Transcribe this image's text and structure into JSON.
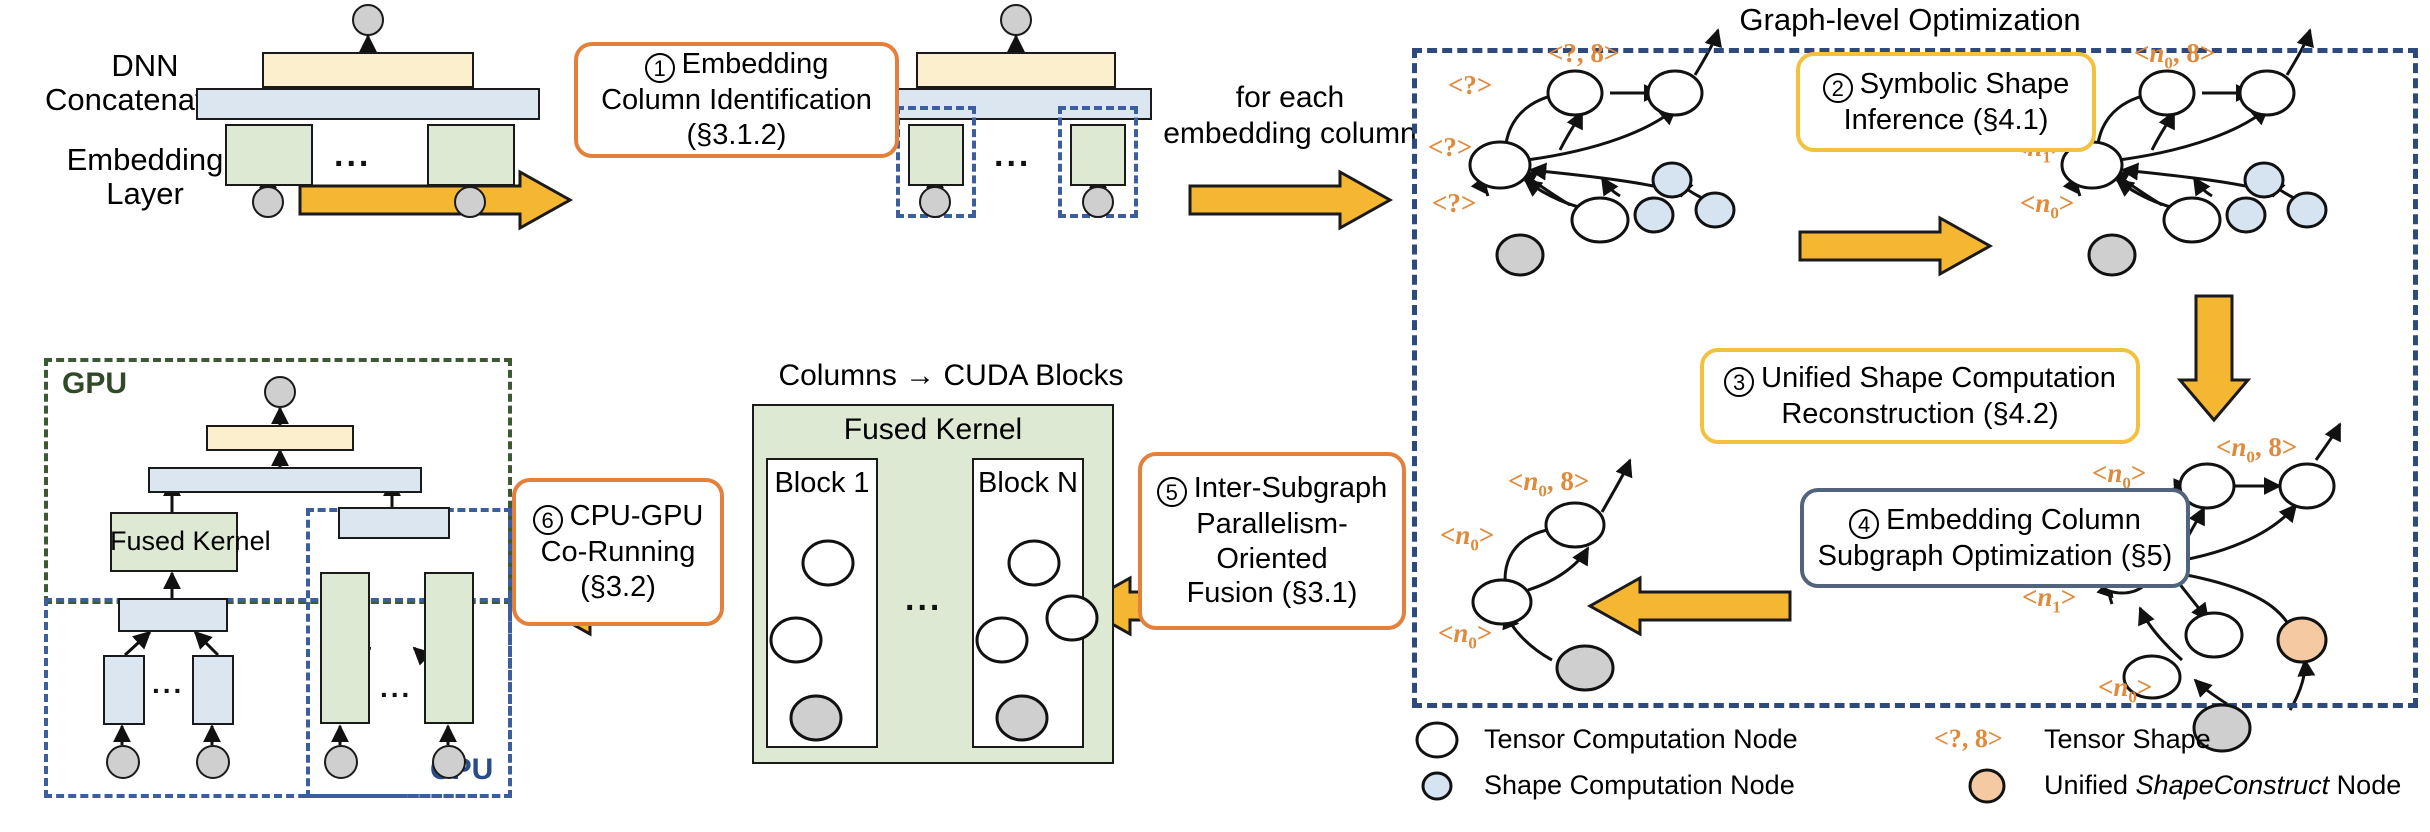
{
  "figure": {
    "panel_titles": {
      "graph_level_optimization": "Graph-level Optimization",
      "columns_to_cuda_blocks": "Columns → CUDA Blocks"
    },
    "left_labels": {
      "dnn": "DNN",
      "concatenation": "Concatenation",
      "embedding": "Embedding",
      "layer": "Layer"
    },
    "flow_labels": {
      "for_each": "for each",
      "embedding_column": "embedding column"
    },
    "device_labels": {
      "gpu": "GPU",
      "cpu": "CPU"
    },
    "kernel_labels": {
      "fused_kernel_left": "Fused Kernel",
      "fused_kernel_center": "Fused Kernel",
      "block_first": "Block 1",
      "block_last": "Block N",
      "ellipsis": "..."
    }
  },
  "steps": [
    {
      "id": 1,
      "number": "①",
      "num_plain": "1",
      "lines": [
        "Embedding",
        "Column Identification",
        "(§3.1.2)"
      ],
      "accent": "#E2803C",
      "style": "orange"
    },
    {
      "id": 2,
      "number": "②",
      "num_plain": "2",
      "lines": [
        "Symbolic Shape",
        "Inference (§4.1)"
      ],
      "accent": "#F2C13E",
      "style": "yellow"
    },
    {
      "id": 3,
      "number": "③",
      "num_plain": "3",
      "lines": [
        "Unified Shape Computation",
        "Reconstruction (§4.2)"
      ],
      "accent": "#F2C13E",
      "style": "yellow"
    },
    {
      "id": 4,
      "number": "④",
      "num_plain": "4",
      "lines": [
        "Embedding Column",
        "Subgraph Optimization (§5)"
      ],
      "accent": "#52637C",
      "style": "navy"
    },
    {
      "id": 5,
      "number": "⑤",
      "num_plain": "5",
      "lines": [
        "Inter-Subgraph",
        "Parallelism-",
        "Oriented",
        "Fusion (§3.1)"
      ],
      "accent": "#E2803C",
      "style": "orange"
    },
    {
      "id": 6,
      "number": "⑥",
      "num_plain": "6",
      "lines": [
        "CPU-GPU",
        "Co-Running",
        "(§3.2)"
      ],
      "accent": "#E2803C",
      "style": "orange"
    }
  ],
  "legend": {
    "items": [
      {
        "key": "tensor-computation-node",
        "label": "Tensor Computation Node",
        "color": "#ffffff",
        "shape": "ellipse"
      },
      {
        "key": "shape-computation-node",
        "label": "Shape Computation Node",
        "color": "#D6E3F0",
        "shape": "ellipse"
      },
      {
        "key": "tensor-shape",
        "label": "Tensor Shape",
        "color": "#E08A3C",
        "shape": "tag",
        "tag_text": "<?, 8>"
      },
      {
        "key": "unified-shapeconstruct-node",
        "label_pre": "Unified ",
        "label_em": "ShapeConstruct",
        "label_post": " Node",
        "label": "Unified ShapeConstruct Node",
        "color": "#F5C9A2",
        "shape": "ellipse"
      }
    ]
  },
  "shape_tags": {
    "unknown": "<?>",
    "unknown_8": "<?, 8>",
    "n0": "<n0>",
    "n1": "<n1>",
    "n0_8": "<n0, 8>"
  },
  "colors": {
    "orange_accent": "#E2803C",
    "yellow_accent": "#F2C13E",
    "navy_accent": "#52637C",
    "dashed_blue": "#3C5E9E",
    "dashed_navy": "#2E4A7D",
    "dashed_green": "#3C5A32",
    "arrow_fill": "#F5B731",
    "arrow_stroke": "#1a1a1a",
    "box_yellow": "#FCEFCD",
    "box_blue": "#DCE6F1",
    "box_green": "#DEE9D4",
    "node_gray": "#CFCFCF",
    "node_shape_blue": "#D6E3F0",
    "node_shapeconstruct": "#F5C9A2"
  }
}
